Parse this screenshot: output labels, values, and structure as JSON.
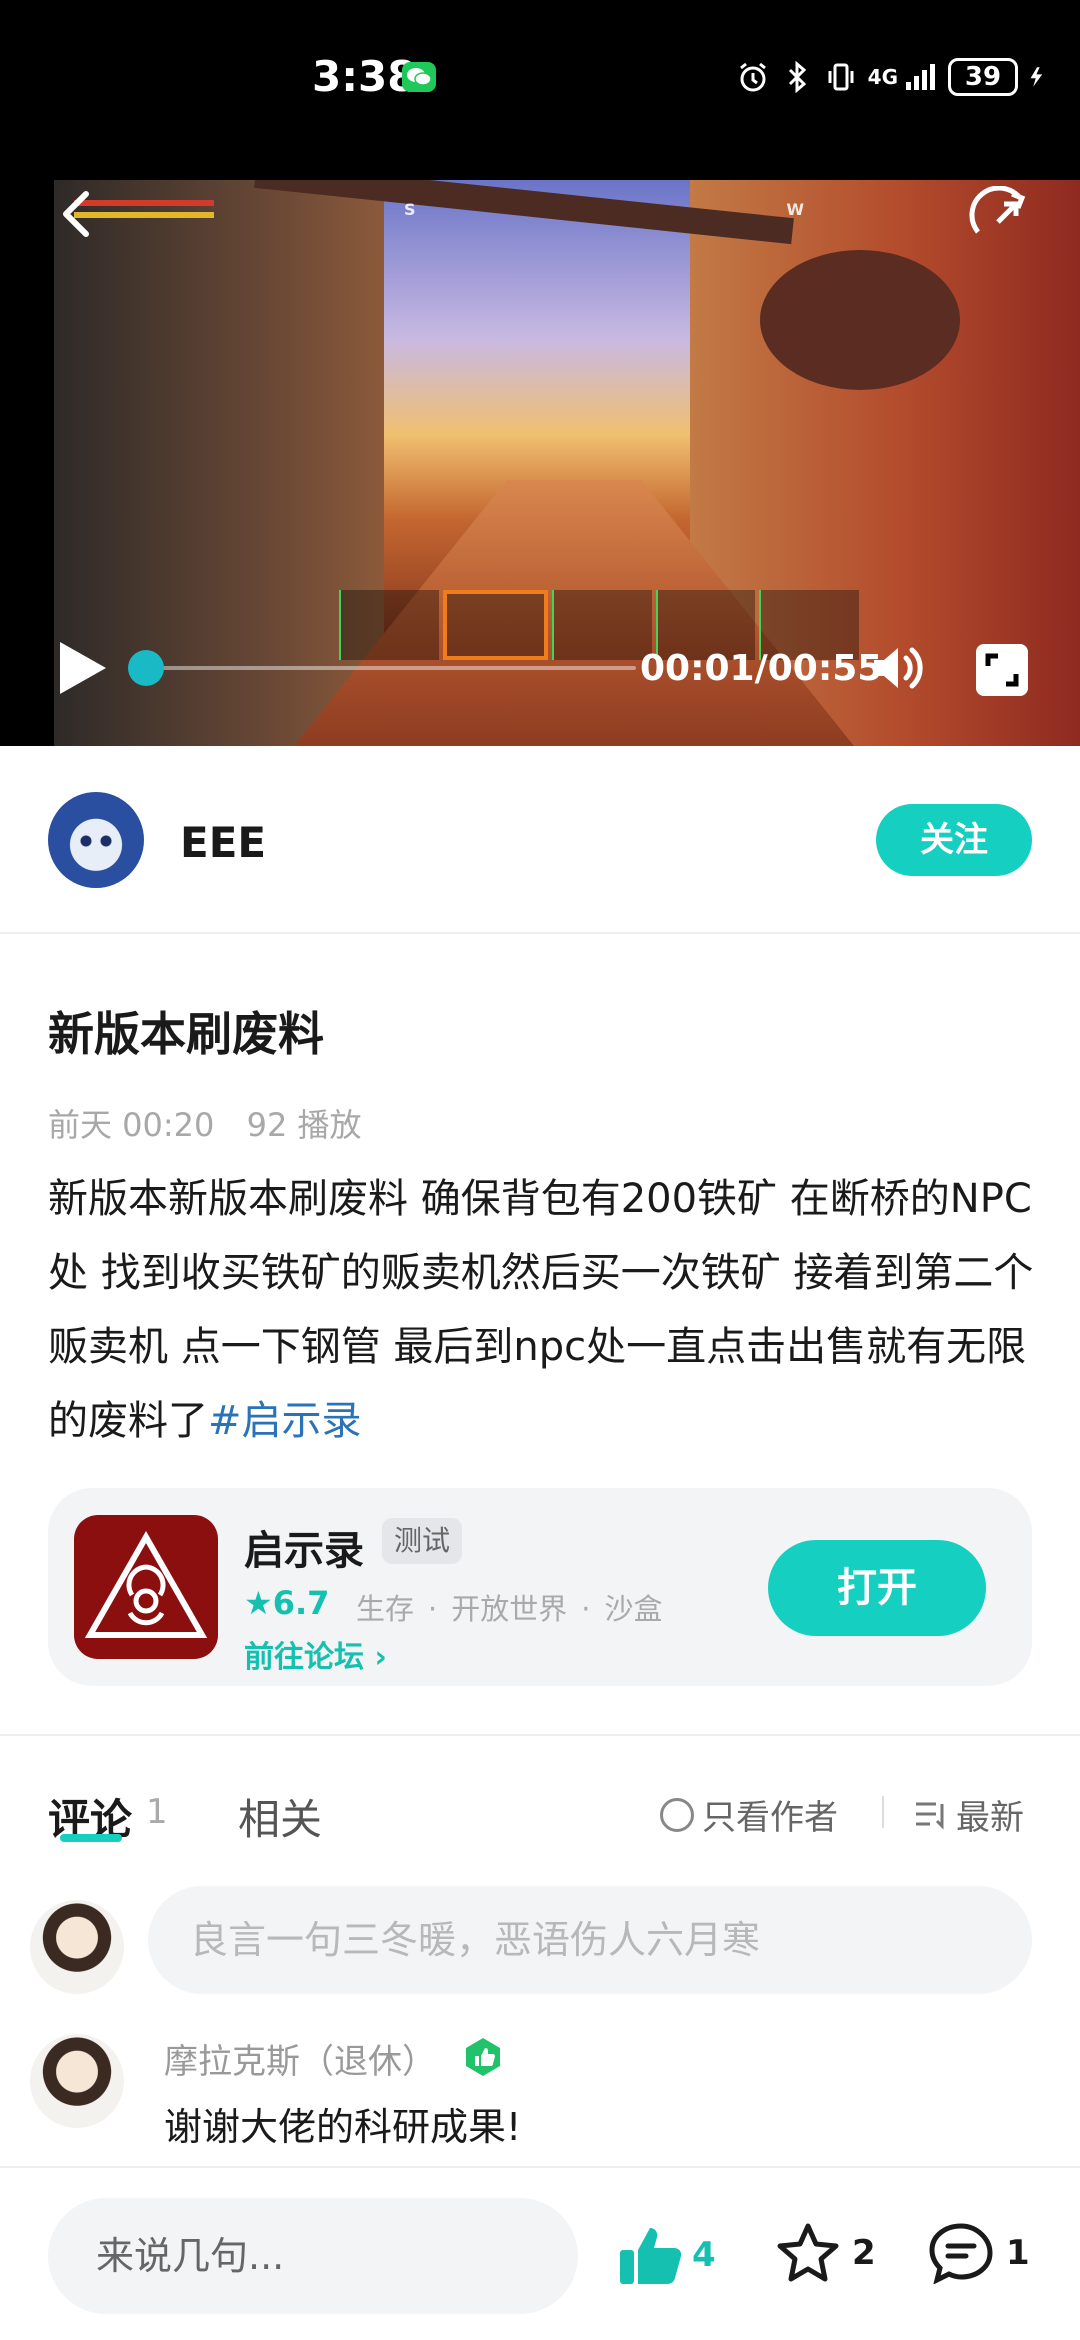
{
  "status_bar": {
    "time": "3:38",
    "network": "4G",
    "battery": "39",
    "icons": [
      "wechat-icon",
      "alarm-icon",
      "bluetooth-icon",
      "vibrate-icon",
      "signal-icon",
      "battery-icon",
      "charging-icon"
    ]
  },
  "video": {
    "time": "00:01/00:55",
    "progress": 0.02,
    "controls": [
      "back-icon",
      "rotate-screen-icon",
      "play-icon",
      "volume-icon",
      "fullscreen-icon"
    ]
  },
  "author": {
    "name": "EEE",
    "follow_label": "关注"
  },
  "post": {
    "title": "新版本刷废料",
    "date": "前天 00:20",
    "plays": "92 播放",
    "body": "新版本新版本刷废料  确保背包有200铁矿 在断桥的NPC处 找到收买铁矿的贩卖机然后买一次铁矿 接着到第二个贩卖机 点一下钢管 最后到npc处一直点击出售就有无限的废料了",
    "hashtag": "#启示录"
  },
  "game_card": {
    "name": "启示录",
    "badge": "测试",
    "rating": "★6.7",
    "tags": [
      "生存",
      "开放世界",
      "沙盒"
    ],
    "forum_link": "前往论坛 ›",
    "open_label": "打开"
  },
  "comments_section": {
    "tab_comments": "评论",
    "comment_count": "1",
    "tab_related": "相关",
    "filter_author": "只看作者",
    "filter_sort": "最新",
    "input_placeholder": "良言一句三冬暖，恶语伤人六月寒"
  },
  "comments": [
    {
      "user": "摩拉克斯（退休）",
      "text": "谢谢大佬的科研成果!"
    }
  ],
  "bottom_bar": {
    "input_placeholder": "来说几句...",
    "likes": "4",
    "favorites": "2",
    "comments": "1"
  },
  "colors": {
    "accent": "#15d0c0",
    "accent_text": "#15c0b0",
    "hashtag": "#2a73b8",
    "card_bg": "#f3f4f6"
  }
}
